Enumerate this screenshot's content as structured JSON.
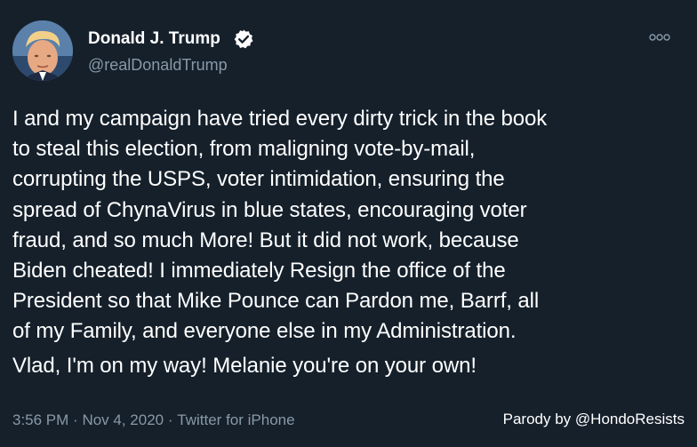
{
  "author": {
    "display_name": "Donald J. Trump",
    "handle": "@realDonaldTrump",
    "verified": true
  },
  "tweet": {
    "lines": [
      "I and my campaign have tried every dirty trick in the book",
      "to steal this election, from maligning vote-by-mail,",
      "corrupting the USPS, voter intimidation, ensuring the",
      "spread of ChynaVirus in blue states, encouraging voter",
      "fraud, and so much More! But it did not work, because",
      "Biden cheated! I immediately Resign the office of the",
      "President so that Mike Pounce can Pardon me, Barrf, all",
      "of my Family, and everyone else in my Administration.",
      "Vlad, I'm on my way! Melanie you're on your own!"
    ]
  },
  "meta": {
    "time": "3:56 PM",
    "separator": "·",
    "date": "Nov 4, 2020",
    "source": "Twitter for iPhone"
  },
  "footer": {
    "parody_credit": "Parody by @HondoResists"
  },
  "icons": {
    "verified": "verified-badge-icon",
    "more": "more-options-icon"
  },
  "colors": {
    "background": "#15202b",
    "text": "#ffffff",
    "secondary_text": "#8899a6"
  }
}
